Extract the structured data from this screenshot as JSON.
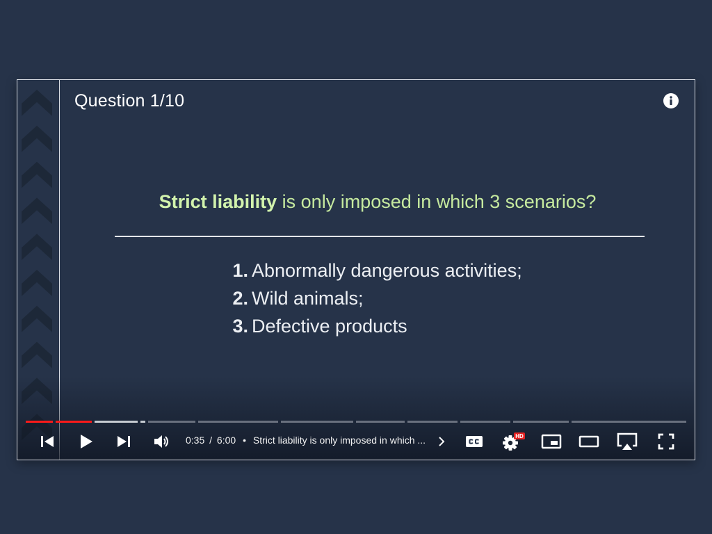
{
  "slide": {
    "counter": "Question 1/10",
    "question_bold": "Strict liability",
    "question_rest": " is only imposed in which 3 scenarios?",
    "answers": [
      {
        "num": "1.",
        "text": "Abnormally dangerous activities;"
      },
      {
        "num": "2.",
        "text": "Wild animals;"
      },
      {
        "num": "3.",
        "text": "Defective products"
      }
    ]
  },
  "player": {
    "current_time": "0:35",
    "time_separator": "/",
    "duration": "6:00",
    "bullet": "•",
    "chapter_title": "Strict liability is only imposed in which ...",
    "hd_badge": "HD",
    "played_fraction": 0.097,
    "buffered_fraction": 0.175,
    "colors": {
      "progress_played": "#ff1a1a",
      "question_green": "#c6ea9f",
      "background": "#263349"
    }
  },
  "icons": [
    "info-icon",
    "skip-previous-icon",
    "play-icon",
    "skip-next-icon",
    "volume-icon",
    "chevron-right-icon",
    "closed-captions-icon",
    "settings-icon",
    "miniplayer-icon",
    "theater-mode-icon",
    "airplay-icon",
    "fullscreen-icon"
  ]
}
